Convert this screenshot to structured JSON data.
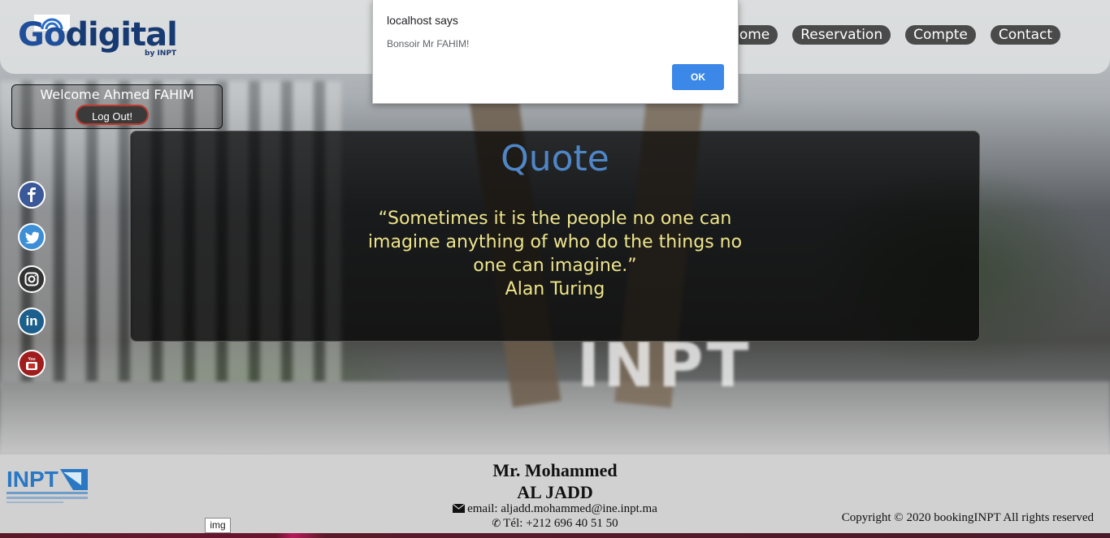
{
  "header": {
    "logo_main_1": "Go",
    "logo_main_2": "digital",
    "logo_sub": "by INPT",
    "nav": [
      "ome",
      "Reservation",
      "Compte",
      "Contact"
    ]
  },
  "welcome": {
    "text": "Welcome Ahmed FAHIM",
    "logout_label": "Log Out!"
  },
  "social": [
    "facebook-icon",
    "twitter-icon",
    "instagram-icon",
    "linkedin-icon",
    "youtube-icon"
  ],
  "quote": {
    "title": "Quote",
    "text": "“Sometimes it is the people no one can imagine anything of who do the things no one can imagine.”",
    "author": "Alan Turing"
  },
  "footer": {
    "name_line1": "Mr. Mohammed",
    "name_line2": "AL JADD",
    "email": "email: aljadd.mohammed@ine.inpt.ma",
    "tel": "Tél: +212 696 40 51 50",
    "copyright": "Copyright © 2020 bookingINPT All rights reserved",
    "logo_text": "INPT"
  },
  "tooltip": "img",
  "dialog": {
    "title": "localhost says",
    "message": "Bonsoir Mr FAHIM!",
    "ok_label": "OK"
  },
  "colors": {
    "quote_title": "#4f86c6",
    "quote_text": "#eee58a",
    "ok_button": "#3b88e8",
    "nav_bg": "#4a4a4a"
  }
}
